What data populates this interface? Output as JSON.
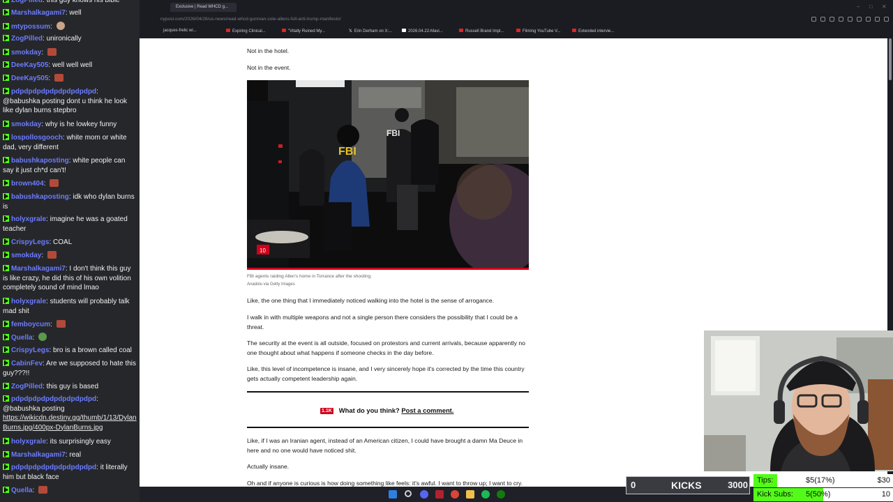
{
  "chat": {
    "messages": [
      {
        "user": "ZogPilled",
        "text": "this guy knows his bible"
      },
      {
        "user": "Marshalkagami7",
        "text": "well"
      },
      {
        "user": "mtypossum",
        "text": ""
      },
      {
        "user": "ZogPilled",
        "text": "unironically"
      },
      {
        "user": "smokday",
        "text": ""
      },
      {
        "user": "DeeKay505",
        "text": "well well well"
      },
      {
        "user": "DeeKay505",
        "text": ""
      },
      {
        "user": "pdpdpdpdpdpdpdpdpdpd",
        "text": "@babushka posting dont u think he look like dylan burns stepbro"
      },
      {
        "user": "smokday",
        "text": "why is he lowkey funny"
      },
      {
        "user": "lospollosgooch",
        "text": "white mom or white dad, very different"
      },
      {
        "user": "babushkaposting",
        "text": "white people can say it just ch*d can't!"
      },
      {
        "user": "brown404",
        "text": ""
      },
      {
        "user": "babushkaposting",
        "text": "idk who dylan burns is"
      },
      {
        "user": "holyxgrale",
        "text": "imagine he was a goated teacher"
      },
      {
        "user": "CrispyLegs",
        "text": "COAL"
      },
      {
        "user": "smokday",
        "text": ""
      },
      {
        "user": "Marshalkagami7",
        "text": "I don't think this guy is like crazy, he did this of his own volition completely sound of mind lmao"
      },
      {
        "user": "holyxgrale",
        "text": "students will probably talk mad shit"
      },
      {
        "user": "femboycum",
        "text": ""
      },
      {
        "user": "Quella",
        "text": ""
      },
      {
        "user": "CrispyLegs",
        "text": "bro is a brown called coal"
      },
      {
        "user": "CabinFev",
        "text": "Are we supposed to hate this guy???!!"
      },
      {
        "user": "ZogPilled",
        "text": "this guy is based"
      },
      {
        "user": "pdpdpdpdpdpdpdpdpdpd",
        "text": "@babushka posting",
        "link": "https://wikicdn.destiny.gg/thumb/1/13/DylanBurns.jpg/400px-DylanBurns.jpg"
      },
      {
        "user": "holyxgrale",
        "text": "its surprisingly easy"
      },
      {
        "user": "Marshalkagami7",
        "text": "real"
      },
      {
        "user": "pdpdpdpdpdpdpdpdpdpd",
        "text": "it literally him but black face"
      },
      {
        "user": "Quella",
        "text": ""
      }
    ]
  },
  "browser": {
    "active_tab": "Exclusive | Read WHCD g...",
    "url": "nypost.com/2026/04/26/us-news/read-whcd-gunman-cole-allens-full-anti-trump-manifesto/",
    "bookmarks": [
      "jacques-frelic wi...",
      "Expiring Clinical...",
      "\"Vitally Ruined My...",
      "Erin Derham on X:...",
      "2026.04.22-Mavi...",
      "Russell Brand Impl...",
      "Filming YouTube V...",
      "Extended intervie..."
    ]
  },
  "article": {
    "p_hotel": "Not in the hotel.",
    "p_event": "Not in the event.",
    "photo_badge": "10",
    "photo_vest": "FBI",
    "photo_vest2": "FBI",
    "caption": "FBI agents raiding Allen's home in Torrance after the shooting.",
    "credit": "Anadolu via Getty Images",
    "p1": "Like, the one thing that I immediately noticed walking into the hotel is the sense of arrogance.",
    "p2": "I walk in with multiple weapons and not a single person there considers the possibility that I could be a threat.",
    "p3": "The security at the event is all outside, focused on protestors and current arrivals, because apparently no one thought about what happens if someone checks in the day before.",
    "p4": "Like, this level of incompetence is insane, and I very sincerely hope it's corrected by the time this country gets actually competent leadership again.",
    "cta_badge": "1.1K",
    "cta_question": "What do you think?",
    "cta_link": "Post a comment.",
    "p5": "Like, if I was an Iranian agent, instead of an American citizen, I could have brought a damn Ma Deuce in here and no one would have noticed shit.",
    "p6": "Actually insane.",
    "p7": "Oh and if anyone is curious is how doing something like feels: it's awful. I want to throw up; I want to cry."
  },
  "widgets": {
    "kicks_label": "KICKS",
    "kicks_current": "0",
    "kicks_goal": "3000",
    "kicks_progress": 0,
    "tips_label": "Tips:",
    "tips_value": "$5(17%)",
    "tips_goal": "$30",
    "tips_progress": 0.17,
    "subs_label": "Kick Subs:",
    "subs_value": "5(50%)",
    "subs_goal": "10",
    "subs_progress": 0.5
  },
  "colors": {
    "kick_green": "#53fc18",
    "chat_bg": "#26272b",
    "username": "#6b7cff",
    "nypost_red": "#d0021b"
  }
}
